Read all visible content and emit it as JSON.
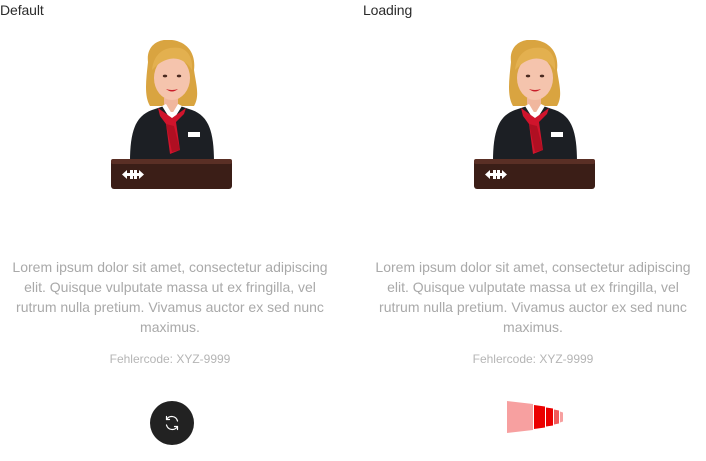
{
  "states": [
    {
      "label": "Default",
      "message": "Lorem ipsum dolor sit amet, consectetur adipiscing elit. Quisque vulputate massa ut ex fringilla, vel rutrum nulla pretium. Vivamus auctor ex sed nunc maximus.",
      "error_code": "Fehlercode: XYZ-9999",
      "action_icon": "reload-icon"
    },
    {
      "label": "Loading",
      "message": "Lorem ipsum dolor sit amet, consectetur adipiscing elit. Quisque vulputate massa ut ex fringilla, vel rutrum nulla pretium. Vivamus auctor ex sed nunc maximus.",
      "error_code": "Fehlercode: XYZ-9999",
      "action_icon": "loading-indicator"
    }
  ],
  "colors": {
    "brand_red": "#eb0000",
    "loader_light": "#f7a0a0",
    "button_bg": "#222222",
    "text_muted": "#a9a9a9"
  }
}
